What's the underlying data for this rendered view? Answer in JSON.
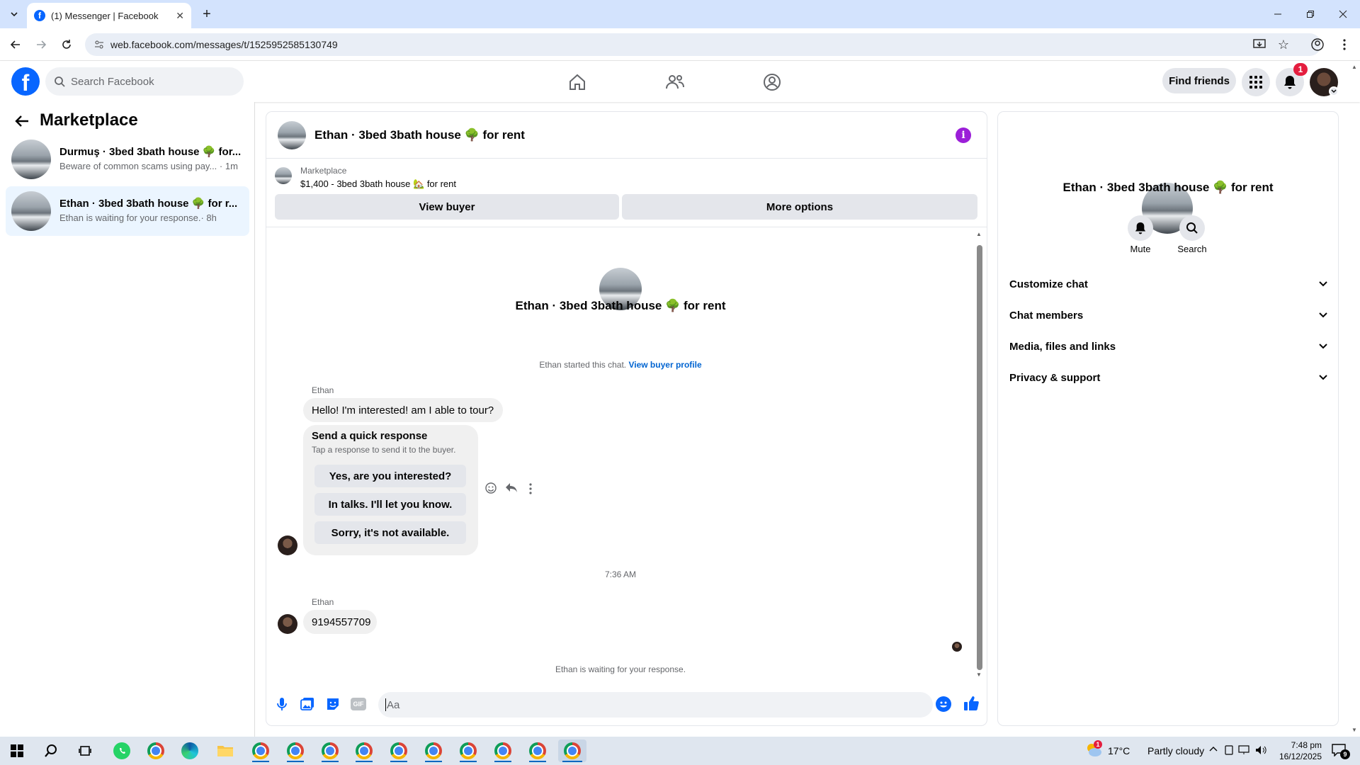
{
  "browser": {
    "tab_title": "(1) Messenger | Facebook",
    "url": "web.facebook.com/messages/t/1525952585130749"
  },
  "fb": {
    "search_placeholder": "Search Facebook",
    "find_friends": "Find friends",
    "notif_count": "1"
  },
  "sidebar": {
    "title": "Marketplace",
    "conversations": [
      {
        "title": "Durmuş · 3bed 3bath house 🌳 for...",
        "preview": "Beware of common scams using pay...",
        "time": "· 1m"
      },
      {
        "title": "Ethan · 3bed 3bath house 🌳 for r...",
        "preview": "Ethan is waiting for your response.",
        "time": "· 8h"
      }
    ]
  },
  "chat": {
    "header_title": "Ethan · 3bed 3bath house 🌳 for rent",
    "listing_label": "Marketplace",
    "listing_desc": "$1,400 - 3bed 3bath house 🏡 for rent",
    "view_buyer": "View buyer",
    "more_options": "More options",
    "center_title": "Ethan · 3bed 3bath house 🌳 for rent",
    "started_text": "Ethan started this chat.",
    "view_buyer_profile": "View buyer profile",
    "sender1": "Ethan",
    "message1": "Hello! I'm interested! am I able to tour?",
    "quick_title": "Send a quick response",
    "quick_sub": "Tap a response to send it to the buyer.",
    "quick_responses": [
      "Yes, are you interested?",
      "In talks. I'll let you know.",
      "Sorry, it's not available."
    ],
    "timestamp": "7:36 AM",
    "sender2": "Ethan",
    "message2": "9194557709",
    "waiting": "Ethan is waiting for your response.",
    "composer_placeholder": "Aa"
  },
  "details": {
    "title": "Ethan · 3bed 3bath house 🌳 for rent",
    "mute": "Mute",
    "search": "Search",
    "sections": [
      "Customize chat",
      "Chat members",
      "Media, files and links",
      "Privacy & support"
    ]
  },
  "taskbar": {
    "weather_temp": "17°C",
    "weather_desc": "Partly cloudy",
    "time": "7:48 pm",
    "date": "16/12/2025",
    "notif_count": "9"
  }
}
